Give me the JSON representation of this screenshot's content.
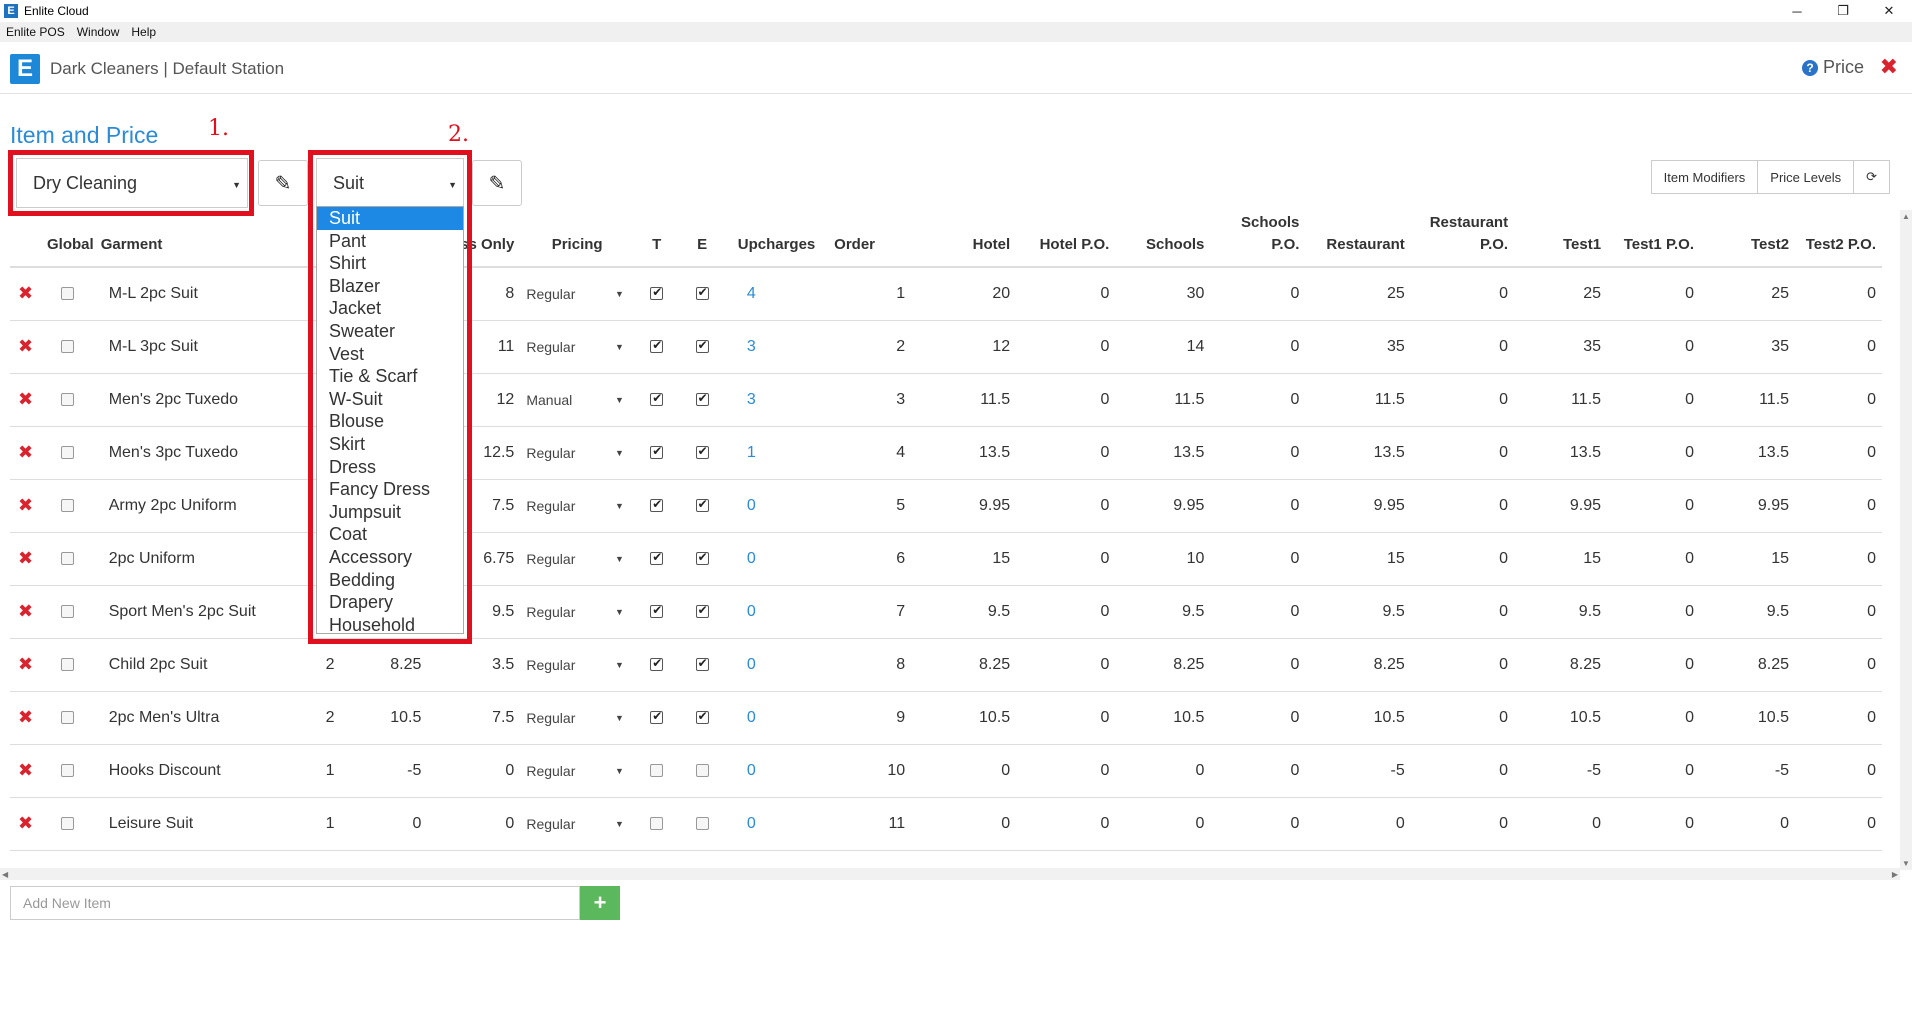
{
  "window": {
    "title": "Enlite Cloud",
    "logo_letter": "E",
    "controls": [
      "─",
      "❐",
      "✕"
    ]
  },
  "menu": [
    "Enlite POS",
    "Window",
    "Help"
  ],
  "header": {
    "station": "Dark Cleaners | Default Station",
    "price_label": "Price",
    "help_icon": "?",
    "close_icon": "✖"
  },
  "page": {
    "title": "Item and Price",
    "category": "Dry Cleaning",
    "garment_type": "Suit",
    "edit_icon": "✎",
    "annotation_1": "1.",
    "annotation_2": "2."
  },
  "buttons": {
    "item_modifiers": "Item Modifiers",
    "price_levels": "Price Levels",
    "refresh_icon": "⟳"
  },
  "garment_options": [
    "Suit",
    "Pant",
    "Shirt",
    "Blazer",
    "Jacket",
    "Sweater",
    "Vest",
    "Tie & Scarf",
    "W-Suit",
    "Blouse",
    "Skirt",
    "Dress",
    "Fancy Dress",
    "Jumpsuit",
    "Coat",
    "Accessory",
    "Bedding",
    "Drapery",
    "Household"
  ],
  "table": {
    "headers": {
      "global": "Global",
      "garment": "Garment",
      "press_only": "Press Only",
      "pricing": "Pricing",
      "t": "T",
      "e": "E",
      "upcharges": "Upcharges",
      "order": "Order",
      "hotel": "Hotel",
      "hotel_po": "Hotel P.O.",
      "schools": "Schools",
      "schools_po": "Schools P.O.",
      "restaurant": "Restaurant",
      "restaurant_po": "Restaurant P.O.",
      "test1": "Test1",
      "test1_po": "Test1 P.O.",
      "test2": "Test2",
      "test2_po": "Test2 P.O."
    },
    "rows": [
      {
        "garment": "M-L 2pc Suit",
        "pieces": "",
        "price": "",
        "press": "8",
        "pricing": "Regular",
        "t": true,
        "e": true,
        "upcharges": "4",
        "order": "1",
        "hotel": "20",
        "hotel_po": "0",
        "schools": "30",
        "schools_po": "0",
        "restaurant": "25",
        "restaurant_po": "0",
        "test1": "25",
        "test1_po": "0",
        "test2": "25",
        "test2_po": "0"
      },
      {
        "garment": "M-L 3pc Suit",
        "pieces": "",
        "price": "",
        "press": "11",
        "pricing": "Regular",
        "t": true,
        "e": true,
        "upcharges": "3",
        "order": "2",
        "hotel": "12",
        "hotel_po": "0",
        "schools": "14",
        "schools_po": "0",
        "restaurant": "35",
        "restaurant_po": "0",
        "test1": "35",
        "test1_po": "0",
        "test2": "35",
        "test2_po": "0"
      },
      {
        "garment": "Men's 2pc Tuxedo",
        "pieces": "",
        "price": "",
        "press": "12",
        "pricing": "Manual",
        "t": true,
        "e": true,
        "upcharges": "3",
        "order": "3",
        "hotel": "11.5",
        "hotel_po": "0",
        "schools": "11.5",
        "schools_po": "0",
        "restaurant": "11.5",
        "restaurant_po": "0",
        "test1": "11.5",
        "test1_po": "0",
        "test2": "11.5",
        "test2_po": "0"
      },
      {
        "garment": "Men's 3pc Tuxedo",
        "pieces": "",
        "price": "",
        "press": "12.5",
        "pricing": "Regular",
        "t": true,
        "e": true,
        "upcharges": "1",
        "order": "4",
        "hotel": "13.5",
        "hotel_po": "0",
        "schools": "13.5",
        "schools_po": "0",
        "restaurant": "13.5",
        "restaurant_po": "0",
        "test1": "13.5",
        "test1_po": "0",
        "test2": "13.5",
        "test2_po": "0"
      },
      {
        "garment": "Army 2pc Uniform",
        "pieces": "",
        "price": "",
        "press": "7.5",
        "pricing": "Regular",
        "t": true,
        "e": true,
        "upcharges": "0",
        "order": "5",
        "hotel": "9.95",
        "hotel_po": "0",
        "schools": "9.95",
        "schools_po": "0",
        "restaurant": "9.95",
        "restaurant_po": "0",
        "test1": "9.95",
        "test1_po": "0",
        "test2": "9.95",
        "test2_po": "0"
      },
      {
        "garment": "2pc Uniform",
        "pieces": "",
        "price": "",
        "press": "6.75",
        "pricing": "Regular",
        "t": true,
        "e": true,
        "upcharges": "0",
        "order": "6",
        "hotel": "15",
        "hotel_po": "0",
        "schools": "10",
        "schools_po": "0",
        "restaurant": "15",
        "restaurant_po": "0",
        "test1": "15",
        "test1_po": "0",
        "test2": "15",
        "test2_po": "0"
      },
      {
        "garment": "Sport Men's 2pc Suit",
        "pieces": "",
        "price": "",
        "press": "9.5",
        "pricing": "Regular",
        "t": true,
        "e": true,
        "upcharges": "0",
        "order": "7",
        "hotel": "9.5",
        "hotel_po": "0",
        "schools": "9.5",
        "schools_po": "0",
        "restaurant": "9.5",
        "restaurant_po": "0",
        "test1": "9.5",
        "test1_po": "0",
        "test2": "9.5",
        "test2_po": "0"
      },
      {
        "garment": "Child 2pc Suit",
        "pieces": "2",
        "price": "8.25",
        "press": "3.5",
        "pricing": "Regular",
        "t": true,
        "e": true,
        "upcharges": "0",
        "order": "8",
        "hotel": "8.25",
        "hotel_po": "0",
        "schools": "8.25",
        "schools_po": "0",
        "restaurant": "8.25",
        "restaurant_po": "0",
        "test1": "8.25",
        "test1_po": "0",
        "test2": "8.25",
        "test2_po": "0"
      },
      {
        "garment": "2pc Men's Ultra",
        "pieces": "2",
        "price": "10.5",
        "press": "7.5",
        "pricing": "Regular",
        "t": true,
        "e": true,
        "upcharges": "0",
        "order": "9",
        "hotel": "10.5",
        "hotel_po": "0",
        "schools": "10.5",
        "schools_po": "0",
        "restaurant": "10.5",
        "restaurant_po": "0",
        "test1": "10.5",
        "test1_po": "0",
        "test2": "10.5",
        "test2_po": "0"
      },
      {
        "garment": "Hooks Discount",
        "pieces": "1",
        "price": "-5",
        "press": "0",
        "pricing": "Regular",
        "t": false,
        "e": false,
        "upcharges": "0",
        "order": "10",
        "hotel": "0",
        "hotel_po": "0",
        "schools": "0",
        "schools_po": "0",
        "restaurant": "-5",
        "restaurant_po": "0",
        "test1": "-5",
        "test1_po": "0",
        "test2": "-5",
        "test2_po": "0"
      },
      {
        "garment": "Leisure Suit",
        "pieces": "1",
        "price": "0",
        "press": "0",
        "pricing": "Regular",
        "t": false,
        "e": false,
        "upcharges": "0",
        "order": "11",
        "hotel": "0",
        "hotel_po": "0",
        "schools": "0",
        "schools_po": "0",
        "restaurant": "0",
        "restaurant_po": "0",
        "test1": "0",
        "test1_po": "0",
        "test2": "0",
        "test2_po": "0"
      }
    ]
  },
  "add_item": {
    "placeholder": "Add New Item",
    "button_icon": "+"
  },
  "colors": {
    "accent": "#2b8bd6",
    "delete": "#d9232e",
    "annotation": "#e0101e",
    "add": "#5cb85c"
  }
}
